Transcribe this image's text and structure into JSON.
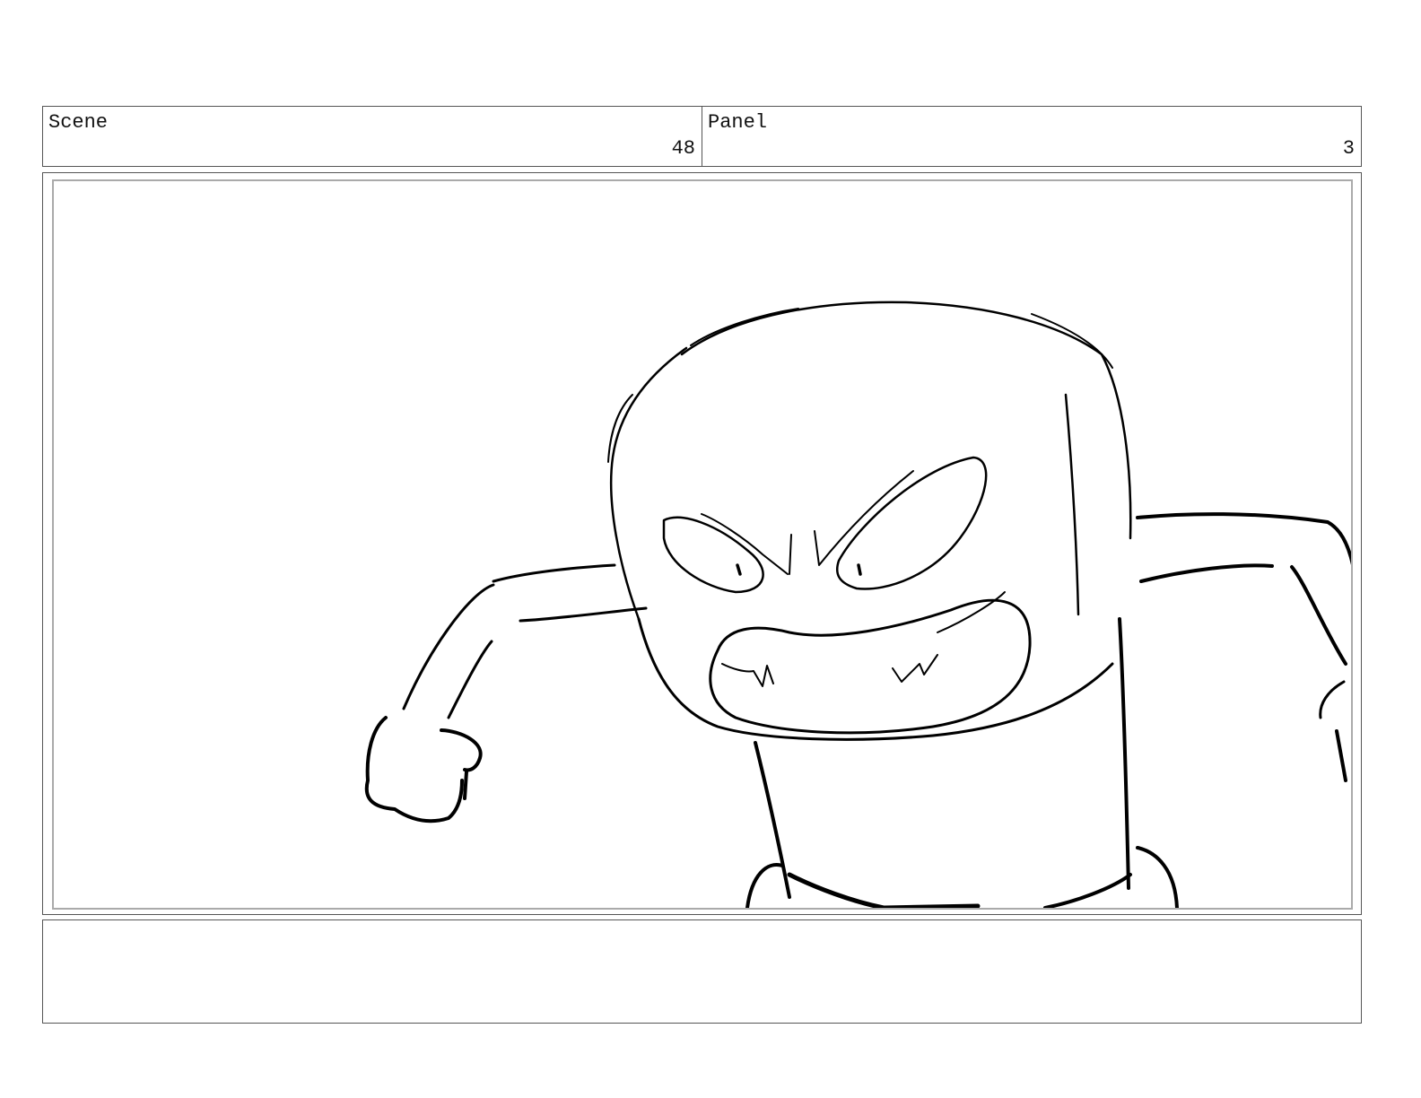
{
  "header": {
    "scene_label": "Scene",
    "scene_number": "48",
    "panel_label": "Panel",
    "panel_number": "3"
  },
  "frame": {
    "subject_icon": "angry-marshmallow-character-sketch"
  },
  "notes": {
    "text": ""
  }
}
